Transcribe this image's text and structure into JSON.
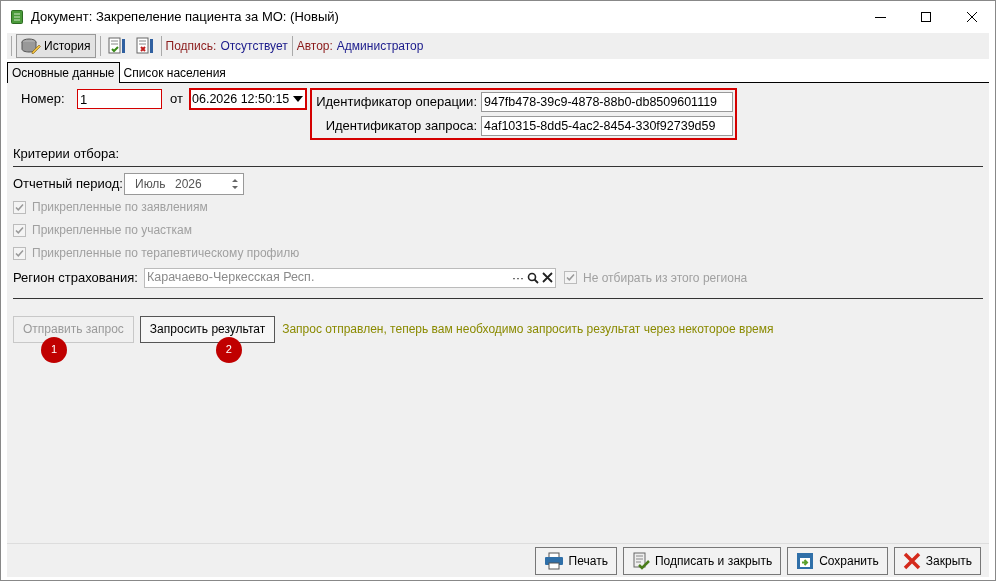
{
  "window": {
    "title": "Документ: Закрепеление пациента за МО:  (Новый)"
  },
  "toolbar": {
    "history_button": "История",
    "signature_label": "Подпись:",
    "signature_value": "Отсутствует",
    "author_label": "Автор:",
    "author_value": "Администратор"
  },
  "tabs": [
    {
      "label": "Основные данные",
      "selected": true
    },
    {
      "label": "Список населения",
      "selected": false
    }
  ],
  "number": {
    "label": "Номер:",
    "value": "1",
    "highlighted": true
  },
  "date": {
    "label": "от",
    "value": "06.2026 12:50:15",
    "highlighted": true
  },
  "ids": {
    "highlighted": true,
    "fields": [
      {
        "label": "Идентификатор операции:",
        "value": "947fb478-39c9-4878-88b0-db8509601119"
      },
      {
        "label": "Идентификатор запроса:",
        "value": "4af10315-8dd5-4ac2-8454-330f92739d59"
      }
    ]
  },
  "criteria": {
    "title": "Критерии отбора:",
    "period_label": "Отчетный период:",
    "period_month": "Июль",
    "period_year": "2026",
    "filters": [
      {
        "label": "Прикрепленные по заявлениям",
        "checked": true,
        "disabled": true
      },
      {
        "label": "Прикрепленные по участкам",
        "checked": true,
        "disabled": true
      },
      {
        "label": "Прикрепленные по терапевтическому профилю",
        "checked": true,
        "disabled": true
      }
    ],
    "region_label": "Регион страхования:",
    "region_value": "Карачаево-Черкесская Респ.",
    "region_dots": "···",
    "exclude": {
      "label": "Не отбирать из этого региона",
      "checked": true,
      "disabled": true
    }
  },
  "actions": [
    {
      "label": "Отправить запрос",
      "disabled": true,
      "callout": "1"
    },
    {
      "label": "Запросить результат",
      "disabled": false,
      "callout": "2"
    }
  ],
  "status_message": "Запрос отправлен, теперь вам необходимо запросить результат через некоторое время",
  "footer_buttons": [
    {
      "kind": "print",
      "label": "Печать"
    },
    {
      "kind": "sign",
      "label": "Подписать и закрыть"
    },
    {
      "kind": "save",
      "label": "Сохранить"
    },
    {
      "kind": "close",
      "label": "Закрыть"
    }
  ]
}
